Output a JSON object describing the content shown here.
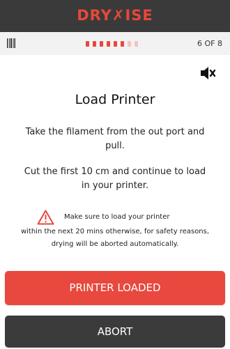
{
  "header": {
    "logo_text": "DRY✗ISE"
  },
  "progress": {
    "current_step": 6,
    "total_steps": 8,
    "label": "6 OF 8",
    "active_color": "#e8473c",
    "inactive_color": "#f3c4bf"
  },
  "icons": {
    "barcode": "barcode-icon",
    "mute": "speaker-mute-icon",
    "warning": "warning-triangle-icon"
  },
  "main": {
    "title": "Load Printer",
    "paragraph_1": "Take the filament from the out port and pull.",
    "paragraph_2": "Cut the first 10 cm and continue to load in your printer."
  },
  "warning": {
    "line_1": "Make sure to load your printer",
    "line_2": "within the next 20 mins otherwise, for safety reasons, drying will be aborted automatically."
  },
  "buttons": {
    "primary_label": "PRINTER LOADED",
    "secondary_label": "ABORT"
  },
  "colors": {
    "brand_red": "#e8473c",
    "header_dark": "#3a3a3a",
    "progress_bg": "#f2f2f2"
  }
}
